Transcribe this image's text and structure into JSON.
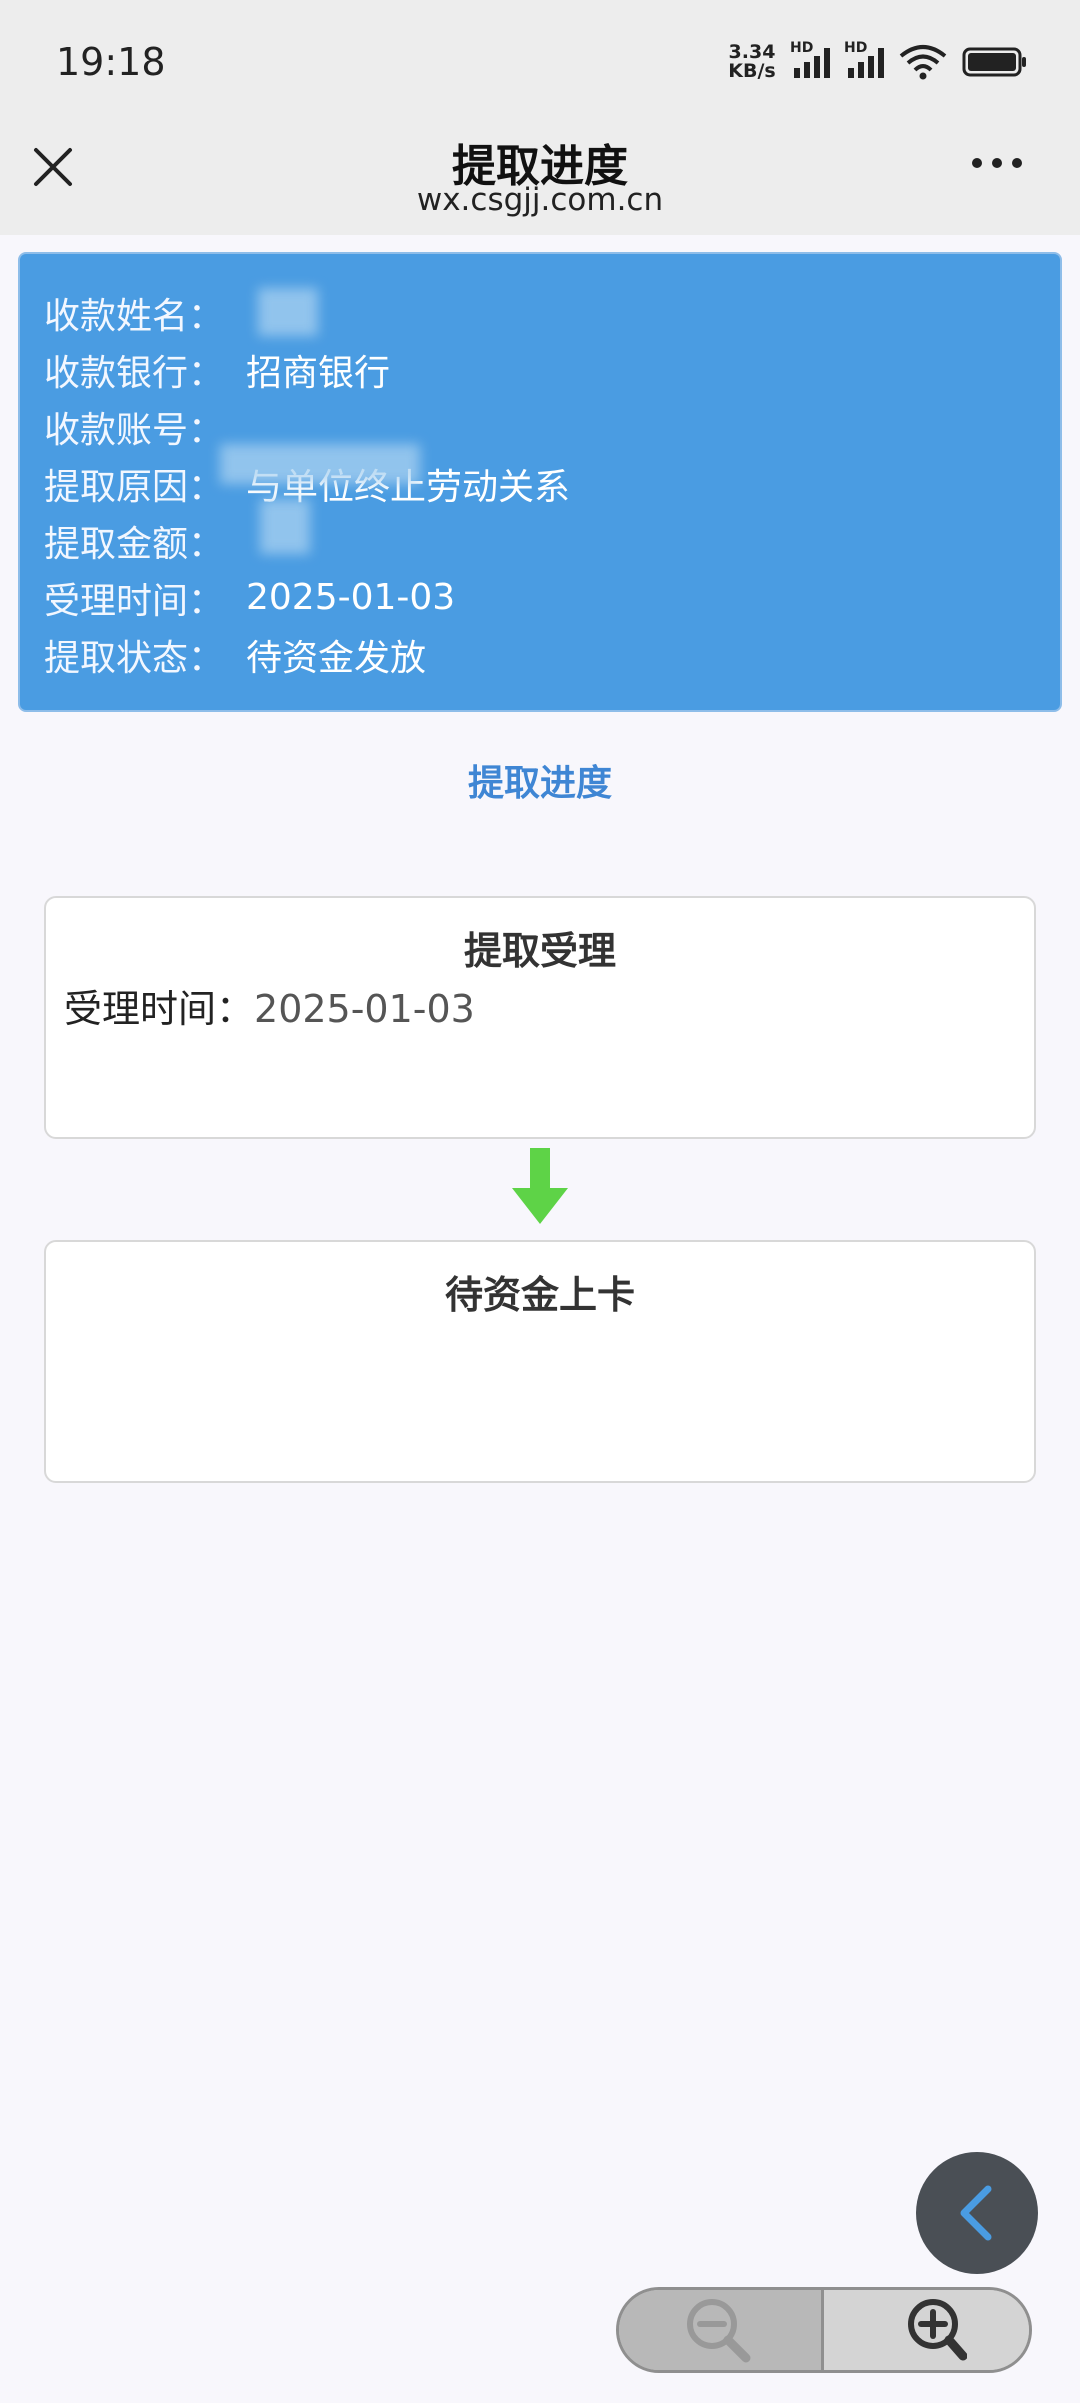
{
  "status_bar": {
    "time": "19:18",
    "net_speed_value": "3.34",
    "net_speed_unit": "KB/s",
    "signal_label_1": "HD",
    "signal_label_2": "HD",
    "icons": [
      "signal-icon",
      "signal-icon",
      "wifi-icon",
      "battery-icon"
    ]
  },
  "title_bar": {
    "title": "提取进度",
    "url": "wx.csgjj.com.cn",
    "icons": [
      "close-icon",
      "more-icon"
    ]
  },
  "info_card": {
    "rows": [
      {
        "label": "收款姓名：",
        "value": ""
      },
      {
        "label": "收款银行：",
        "value": "招商银行"
      },
      {
        "label": "收款账号：",
        "value": ""
      },
      {
        "label": "提取原因：",
        "value": "与单位终止劳动关系"
      },
      {
        "label": "提取金额：",
        "value": ""
      },
      {
        "label": "受理时间：",
        "value": "2025-01-03"
      },
      {
        "label": "提取状态：",
        "value": "待资金发放"
      }
    ],
    "background_color": "#4a9ce2"
  },
  "section_title": "提取进度",
  "steps": [
    {
      "title": "提取受理",
      "detail_label": "受理时间：",
      "detail_value": "2025-01-03"
    },
    {
      "title": "待资金上卡"
    }
  ],
  "colors": {
    "accent": "#3f86d4",
    "arrow": "#5ed347"
  },
  "controls": {
    "icons": [
      "chevron-left-icon",
      "zoom-out-icon",
      "zoom-in-icon"
    ]
  }
}
